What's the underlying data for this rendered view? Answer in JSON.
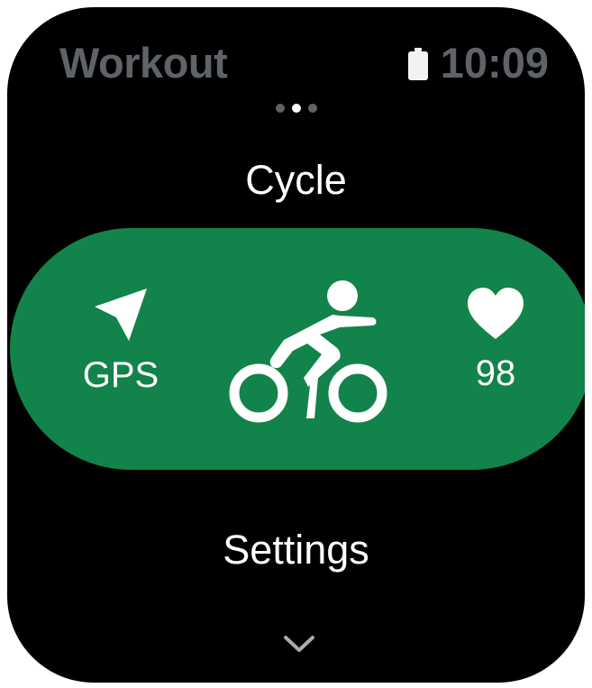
{
  "header": {
    "app_title": "Workout",
    "time": "10:09"
  },
  "pager": {
    "total": 3,
    "active_index": 1
  },
  "activity": {
    "title": "Cycle",
    "gps_label": "GPS",
    "heart_rate": "98",
    "icons": [
      "navigation-arrow-icon",
      "bicycle-icon",
      "heart-icon"
    ]
  },
  "settings": {
    "label": "Settings"
  },
  "colors": {
    "background": "#000000",
    "accent": "#12834a",
    "dim_text": "#5f6368",
    "text": "#ffffff"
  }
}
